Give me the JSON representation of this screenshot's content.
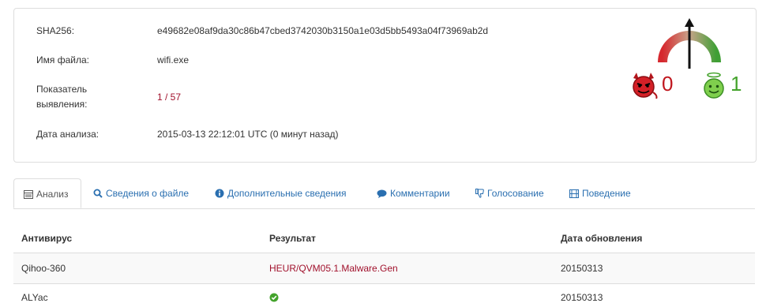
{
  "file_info": {
    "sha256_label": "SHA256:",
    "sha256_value": "e49682e08af9da30c86b47cbed3742030b3150a1e03d5bb5493a04f73969ab2d",
    "filename_label": "Имя файла:",
    "filename_value": "wifi.exe",
    "detection_label_line1": "Показатель",
    "detection_label_line2": "выявления:",
    "detection_value": "1 / 57",
    "date_label": "Дата анализа:",
    "date_value": "2015-03-13 22:12:01 UTC (0 минут назад)"
  },
  "community": {
    "malicious_votes": "0",
    "harmless_votes": "1",
    "gauge_icon": "needle-gauge-icon",
    "malicious_icon": "devil-face-icon",
    "harmless_icon": "angel-smiley-icon",
    "malicious_color": "#c0171f",
    "harmless_color": "#44a32c"
  },
  "tabs": [
    {
      "label": "Анализ",
      "icon": "table-list-icon"
    },
    {
      "label": "Сведения о файле",
      "icon": "magnifier-icon"
    },
    {
      "label": "Дополнительные сведения",
      "icon": "info-circle-icon"
    },
    {
      "label": "Комментарии",
      "icon": "speech-bubble-icon"
    },
    {
      "label": "Голосование",
      "icon": "thumbs-down-icon"
    },
    {
      "label": "Поведение",
      "icon": "film-strip-icon"
    }
  ],
  "table": {
    "headers": [
      "Антивирус",
      "Результат",
      "Дата обновления"
    ],
    "rows": [
      {
        "antivirus": "Qihoo-360",
        "result": "HEUR/QVM05.1.Malware.Gen",
        "updated": "20150313"
      },
      {
        "antivirus": "ALYac",
        "result": "",
        "result_icon": "check-circle-icon",
        "updated": "20150313"
      }
    ]
  },
  "colors": {
    "link": "#2a6fb0",
    "detection": "#a1112c",
    "clean": "#44a32c"
  }
}
